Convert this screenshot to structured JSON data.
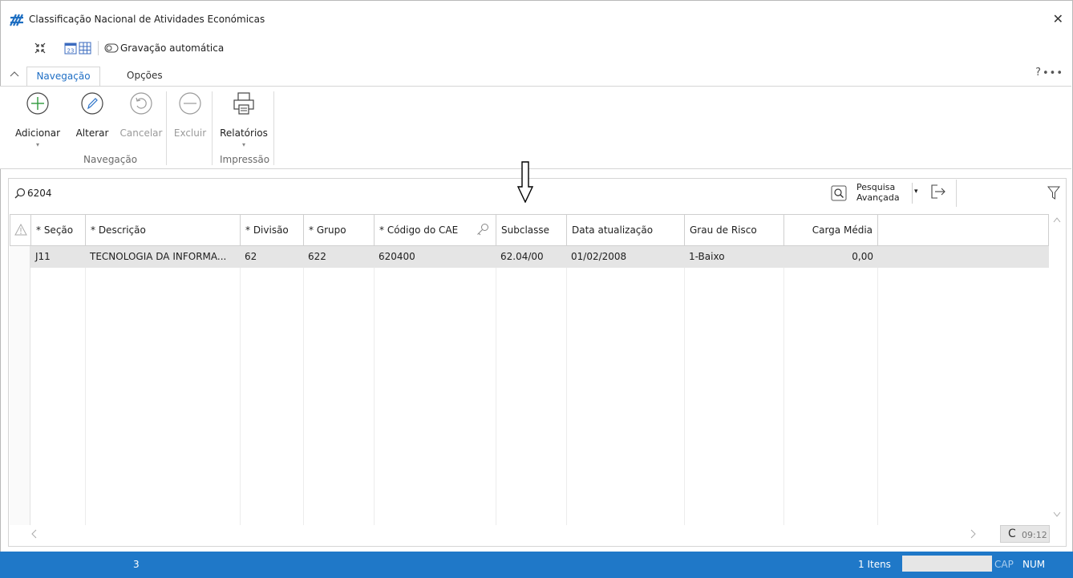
{
  "window": {
    "title": "Classificação Nacional de Atividades Económicas",
    "close_glyph": "✕"
  },
  "quickbar": {
    "icons": [
      "collapse-arrows-icon",
      "calendar-icon",
      "grid-icon"
    ],
    "calendar_number": "23",
    "autosave_label": "Gravação automática"
  },
  "ribbon": {
    "collapse_glyph": "^",
    "tabs": [
      {
        "label": "Navegação",
        "active": true
      },
      {
        "label": "Opções",
        "active": false
      }
    ],
    "help_glyph": "?",
    "more_glyph": "•••",
    "buttons": [
      {
        "label": "Adicionar",
        "icon": "plus-circle-icon",
        "enabled": true,
        "has_dropdown": true
      },
      {
        "label": "Alterar",
        "icon": "pencil-circle-icon",
        "enabled": true,
        "has_dropdown": false
      },
      {
        "label": "Cancelar",
        "icon": "undo-circle-icon",
        "enabled": false,
        "has_dropdown": false
      },
      {
        "label": "Excluir",
        "icon": "minus-circle-icon",
        "enabled": false,
        "has_dropdown": false
      },
      {
        "label": "Relatórios",
        "icon": "printer-icon",
        "enabled": true,
        "has_dropdown": true
      }
    ],
    "groups": [
      {
        "label": "Navegação"
      },
      {
        "label": "Impressão"
      }
    ],
    "dropdown_glyph": "▾"
  },
  "search": {
    "value": "6204",
    "placeholder": "",
    "advanced_line1": "Pesquisa",
    "advanced_line2": "Avançada",
    "dropdown_glyph": "▾"
  },
  "table": {
    "columns": [
      "* Seção",
      "* Descrição",
      "* Divisão",
      "* Grupo",
      "* Código do CAE",
      "Subclasse",
      "Data atualização",
      "Grau de Risco",
      "Carga Média"
    ],
    "rows": [
      {
        "secao": "J11",
        "descricao": "TECNOLOGIA DA INFORMA...",
        "divisao": "62",
        "grupo": "622",
        "codigo_cae": "620400",
        "subclasse": "62.04/00",
        "data_atualizacao": "01/02/2008",
        "grau_risco": "1-Baixo",
        "carga_media": "0,00"
      }
    ]
  },
  "scroll": {
    "up_glyph": "^",
    "down_glyph": "v",
    "left_glyph": "<",
    "right_glyph": ">"
  },
  "refresh": {
    "glyph": "C",
    "time": "09:12"
  },
  "statusbar": {
    "left_value": "3",
    "items_count": "1 Itens",
    "cap": "CAP",
    "num": "NUM"
  },
  "colors": {
    "accent_blue": "#1f78c8",
    "tab_active_text": "#1f6fc5",
    "selected_row": "#e5e5e5",
    "logo_blue": "#1e6fc2"
  }
}
